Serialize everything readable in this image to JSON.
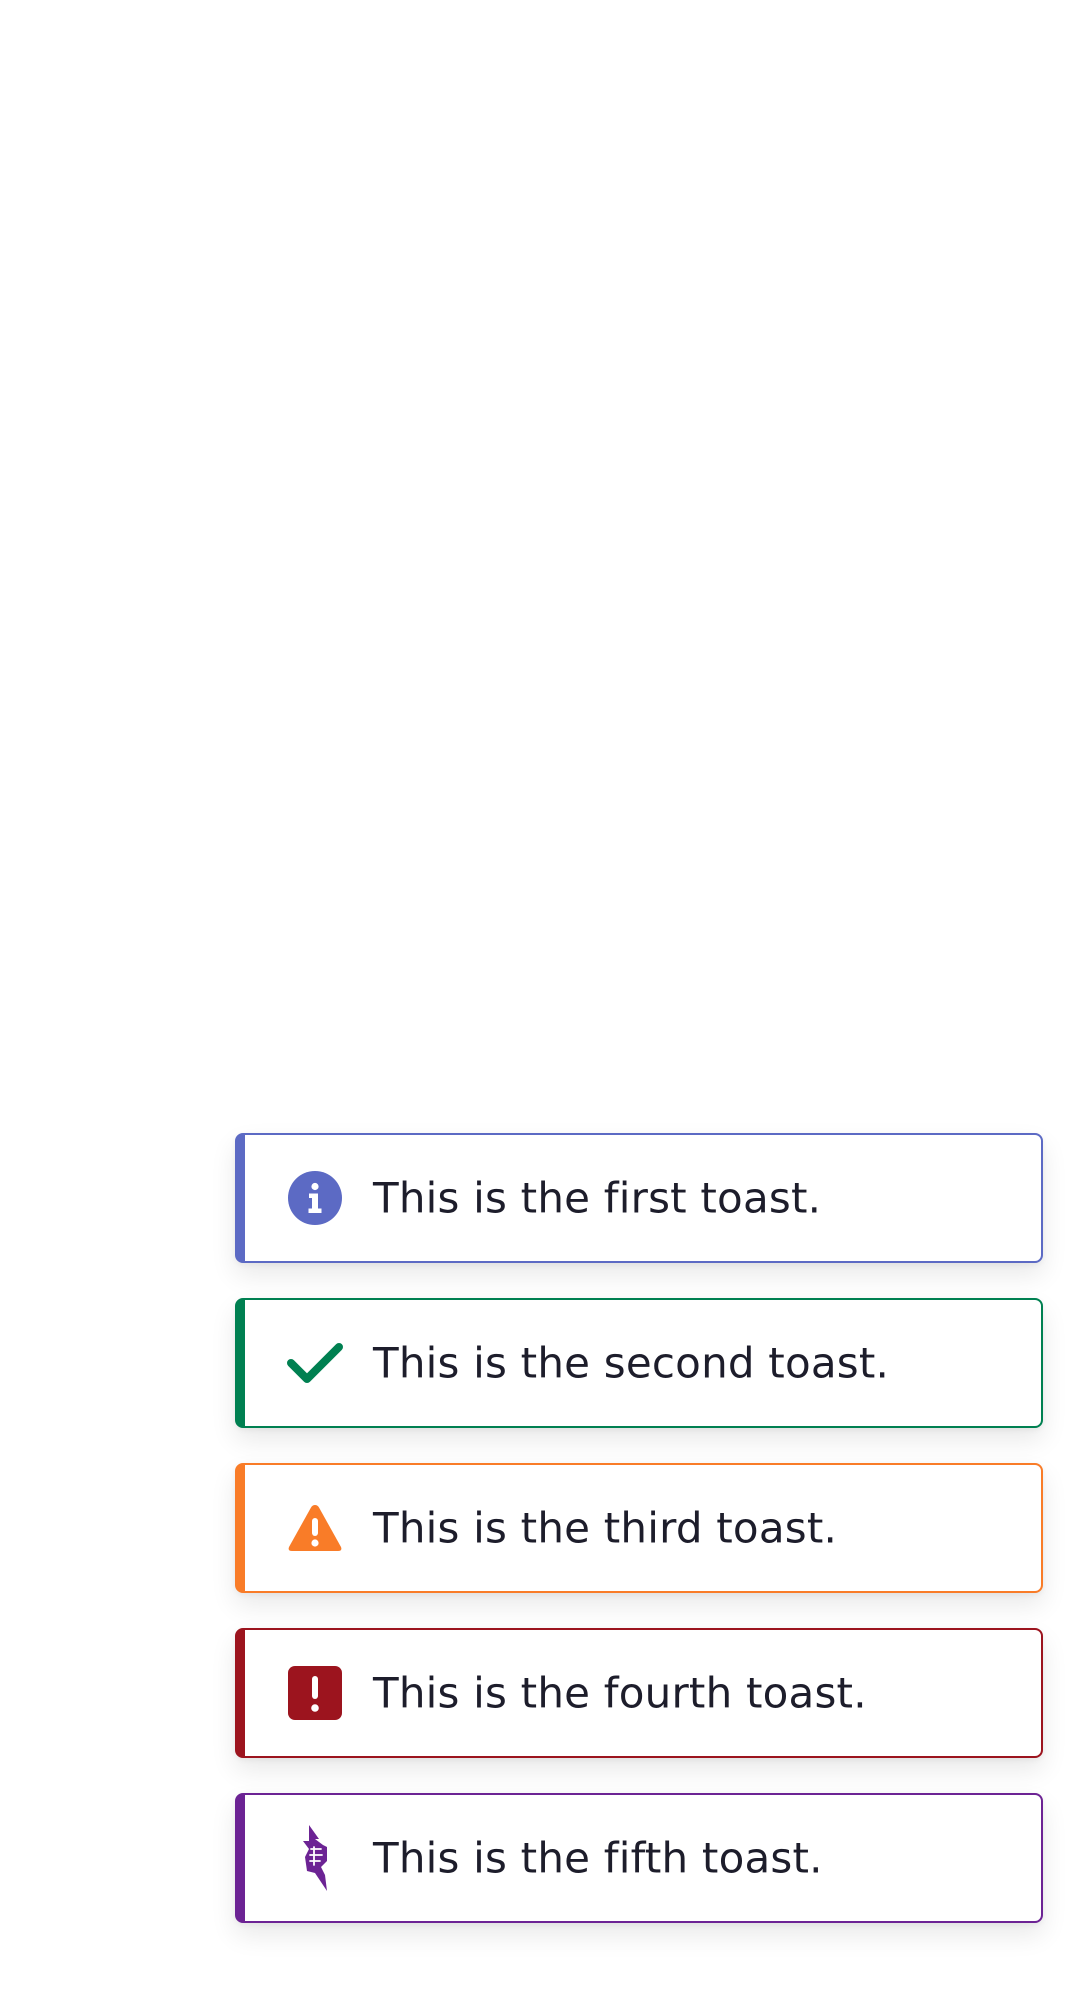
{
  "toasts": [
    {
      "type": "info",
      "icon": "info-icon",
      "color": "#5c6ac4",
      "message": "This is the first toast."
    },
    {
      "type": "success",
      "icon": "checkmark-icon",
      "color": "#008051",
      "message": "This is the second toast."
    },
    {
      "type": "warning",
      "icon": "warning-icon",
      "color": "#f97c28",
      "message": "This is the third toast."
    },
    {
      "type": "error",
      "icon": "error-icon",
      "color": "#9c141e",
      "message": "This is the fourth toast."
    },
    {
      "type": "custom",
      "icon": "lightning-fist-icon",
      "color": "#6c2394",
      "message": "This is the fifth toast."
    }
  ]
}
